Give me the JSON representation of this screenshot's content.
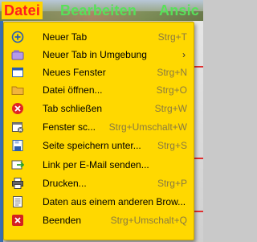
{
  "menubar": {
    "file": "Datei",
    "edit": "Bearbeiten",
    "view": "Ansic"
  },
  "menu": {
    "items": [
      {
        "label": "Neuer Tab",
        "shortcut": "Strg+T",
        "icon": "new-tab-icon"
      },
      {
        "label": "Neuer Tab in Umgebung",
        "shortcut": "",
        "icon": "new-tab-container-icon",
        "submenu": "›"
      },
      {
        "label": "Neues Fenster",
        "shortcut": "Strg+N",
        "icon": "new-window-icon"
      },
      {
        "label": "Datei öffnen...",
        "shortcut": "Strg+O",
        "icon": "folder-icon"
      },
      {
        "label": "Tab schließen",
        "shortcut": "Strg+W",
        "icon": "close-tab-icon"
      },
      {
        "label": "Fenster sc...",
        "shortcut": "Strg+Umschalt+W",
        "icon": "close-window-icon"
      },
      {
        "label": "Seite speichern unter...",
        "shortcut": "Strg+S",
        "icon": "save-icon"
      },
      {
        "label": "Link per E-Mail senden...",
        "shortcut": "",
        "icon": "email-link-icon"
      },
      {
        "label": "Drucken...",
        "shortcut": "Strg+P",
        "icon": "printer-icon"
      },
      {
        "label": "Daten aus einem anderen Brow...",
        "shortcut": "",
        "icon": "import-icon"
      },
      {
        "label": "Beenden",
        "shortcut": "Strg+Umschalt+Q",
        "icon": "quit-icon"
      }
    ]
  },
  "colors": {
    "menu_bg": "#ffd800",
    "file_text": "#ff1e1e",
    "menubar_text": "#58e05a",
    "shortcut_text": "#8a7a40"
  }
}
